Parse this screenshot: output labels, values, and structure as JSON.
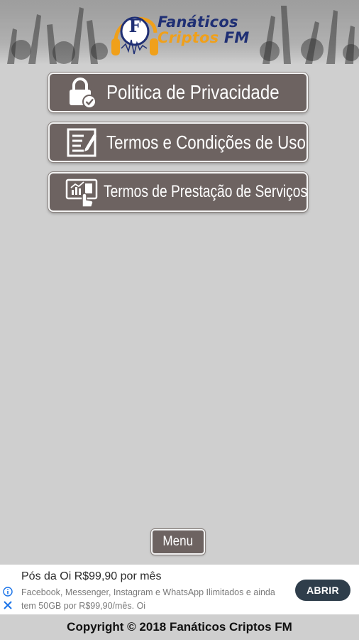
{
  "header": {
    "logo_line1": "Fanáticos",
    "logo_line2_a": "Criptos",
    "logo_line2_b": "FM",
    "logo_emblem_letter": "F"
  },
  "buttons": [
    {
      "label": "Politica de Privacidade",
      "icon": "lock-check-icon"
    },
    {
      "label": "Termos e Condições de Uso",
      "icon": "document-edit-icon"
    },
    {
      "label": "Termos de Prestação de Serviços",
      "icon": "screen-touch-icon"
    }
  ],
  "menu_button": {
    "label": "Menu"
  },
  "ad": {
    "title": "Pós da Oi R$99,90 por mês",
    "description": "Facebook, Messenger, Instagram e WhatsApp Ilimitados e ainda tem 50GB por R$99,90/mês. Oi",
    "cta": "ABRIR",
    "info_icon": "info-icon",
    "close_icon": "close-icon"
  },
  "footer": {
    "copyright": "Copyright © 2018 Fanáticos Criptos FM"
  },
  "colors": {
    "background": "#cfcfcf",
    "button_fill": "#6d6361",
    "logo_blue": "#1f2f74",
    "logo_orange": "#f0a01a",
    "ad_cta": "#2f3e4b"
  }
}
